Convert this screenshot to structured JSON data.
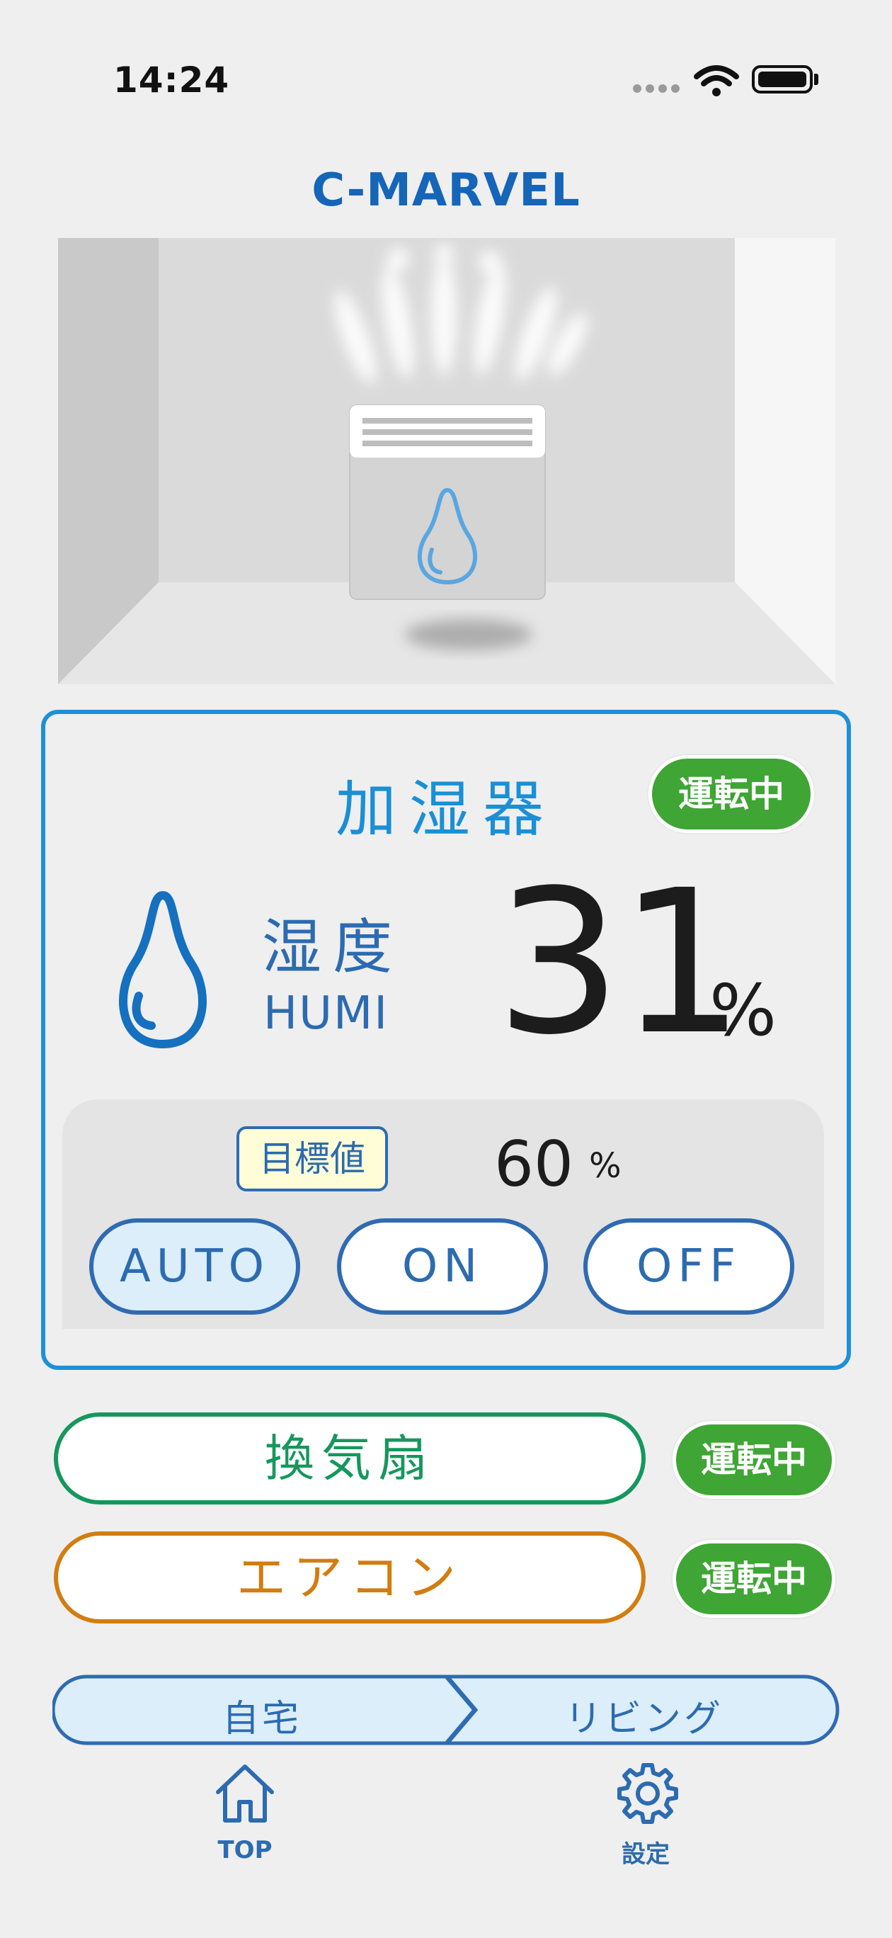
{
  "status_bar": {
    "time": "14:24"
  },
  "app": {
    "title": "C-MARVEL"
  },
  "humidifier": {
    "title": "加湿器",
    "status": "運転中",
    "label_jp": "湿度",
    "label_en": "HUMI",
    "humidity_value": "31",
    "humidity_unit": "%",
    "target_label": "目標値",
    "target_value": "60",
    "target_unit": "%",
    "modes": [
      "AUTO",
      "ON",
      "OFF"
    ],
    "selected_mode": "AUTO"
  },
  "devices": [
    {
      "name": "換気扇",
      "status": "運転中",
      "color": "#16975d"
    },
    {
      "name": "エアコン",
      "status": "運転中",
      "color": "#d27d10"
    }
  ],
  "breadcrumb": [
    "自宅",
    "リビング"
  ],
  "nav": [
    {
      "label": "TOP",
      "icon": "home-icon"
    },
    {
      "label": "設定",
      "icon": "gear-icon"
    }
  ],
  "colors": {
    "brand": "#1565b8",
    "accent": "#1e90d8",
    "running": "#3fa535"
  }
}
